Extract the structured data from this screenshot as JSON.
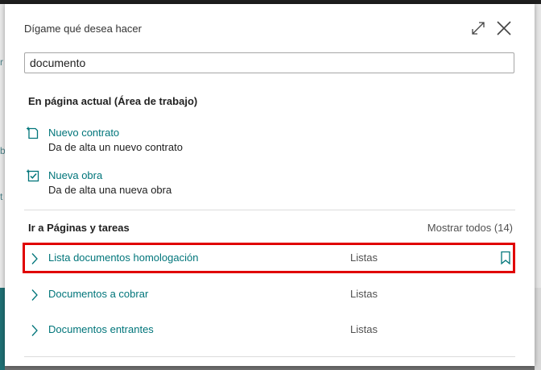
{
  "background": {
    "left_fragments": [
      "r",
      "b",
      "t"
    ],
    "right_fragments": [
      "Re",
      "r"
    ]
  },
  "dialog": {
    "title": "Dígame qué desea hacer",
    "expand_icon": "expand-icon",
    "close_icon": "close-icon"
  },
  "search": {
    "value": "documento",
    "placeholder": ""
  },
  "current_page": {
    "heading": "En página actual (Área de trabajo)",
    "actions": [
      {
        "icon": "new-document-icon",
        "title": "Nuevo contrato",
        "description": "Da de alta un nuevo contrato"
      },
      {
        "icon": "new-task-icon",
        "title": "Nueva obra",
        "description": "Da de alta una nueva obra"
      }
    ]
  },
  "pages": {
    "heading": "Ir a Páginas y tareas",
    "show_all": "Mostrar todos (14)",
    "rows": [
      {
        "name": "Lista documentos homologación",
        "category": "Listas",
        "bookmark": true,
        "highlighted": true
      },
      {
        "name": "Documentos a cobrar",
        "category": "Listas",
        "bookmark": false
      },
      {
        "name": "Documentos entrantes",
        "category": "Listas",
        "bookmark": false
      }
    ]
  },
  "colors": {
    "link": "#00757a",
    "highlight": "#e00000"
  }
}
